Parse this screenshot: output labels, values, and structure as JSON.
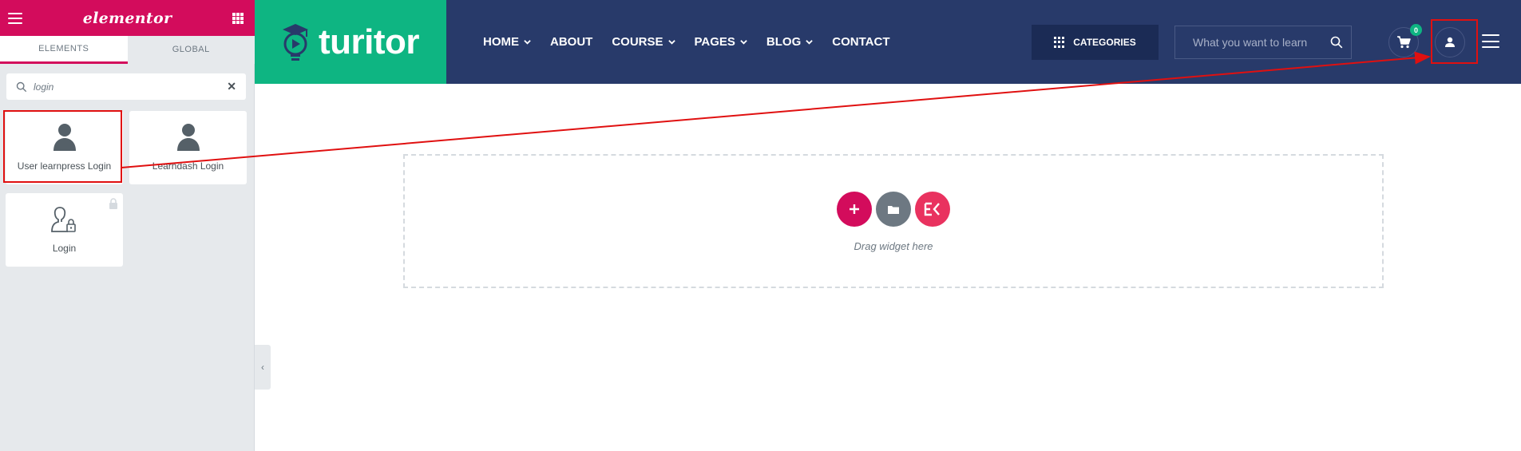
{
  "panel": {
    "brand": "elementor",
    "tabs": {
      "elements": "ELEMENTS",
      "global": "GLOBAL"
    },
    "search": {
      "value": "login"
    },
    "widgets": [
      {
        "label": "User learnpress Login",
        "icon": "user-icon"
      },
      {
        "label": "Learndash Login",
        "icon": "user-icon"
      },
      {
        "label": "Login",
        "icon": "user-lock-icon",
        "locked": true
      }
    ]
  },
  "site": {
    "logo": "turitor",
    "nav": [
      {
        "label": "HOME",
        "has_dropdown": true
      },
      {
        "label": "ABOUT",
        "has_dropdown": false
      },
      {
        "label": "COURSE",
        "has_dropdown": true
      },
      {
        "label": "PAGES",
        "has_dropdown": true
      },
      {
        "label": "BLOG",
        "has_dropdown": true
      },
      {
        "label": "CONTACT",
        "has_dropdown": false
      }
    ],
    "categories_label": "CATEGORIES",
    "search_placeholder": "What you want to learn",
    "cart_count": "0"
  },
  "canvas": {
    "drag_text": "Drag widget here"
  },
  "colors": {
    "elementor_pink": "#d30c5c",
    "header_navy": "#283a6a",
    "logo_green": "#0eb582",
    "annotation_red": "#e01010"
  }
}
